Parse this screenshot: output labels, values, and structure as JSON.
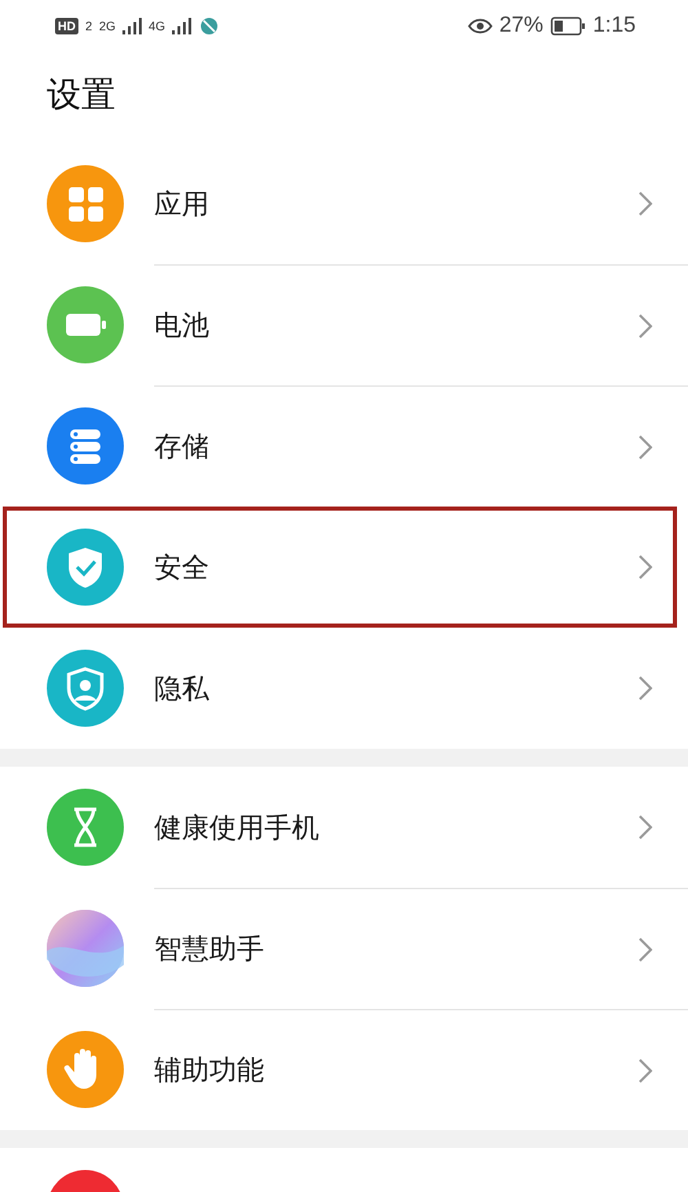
{
  "status_bar": {
    "hd": "HD",
    "sim": "2",
    "networks": [
      "2G",
      "4G"
    ],
    "battery_percent": "27%",
    "time": "1:15"
  },
  "title": "设置",
  "groups": [
    {
      "items": [
        {
          "label": "应用",
          "kind": "apps",
          "color": "#f7960e",
          "highlighted": false
        },
        {
          "label": "电池",
          "kind": "battery",
          "color": "#5cc251",
          "highlighted": false
        },
        {
          "label": "存储",
          "kind": "storage",
          "color": "#1a7ff0",
          "highlighted": false
        },
        {
          "label": "安全",
          "kind": "security",
          "color": "#19b6c6",
          "highlighted": true
        },
        {
          "label": "隐私",
          "kind": "privacy",
          "color": "#19b6c6",
          "highlighted": false
        }
      ]
    },
    {
      "items": [
        {
          "label": "健康使用手机",
          "kind": "wellbeing",
          "color": "#3dbf4f",
          "highlighted": false
        },
        {
          "label": "智慧助手",
          "kind": "assistant",
          "color": "#c9a6e6",
          "highlighted": false
        },
        {
          "label": "辅助功能",
          "kind": "accessibility",
          "color": "#f7960e",
          "highlighted": false
        }
      ]
    },
    {
      "items": [
        {
          "kind": "partial",
          "color": "#ee2b32",
          "highlighted": false
        }
      ]
    }
  ]
}
